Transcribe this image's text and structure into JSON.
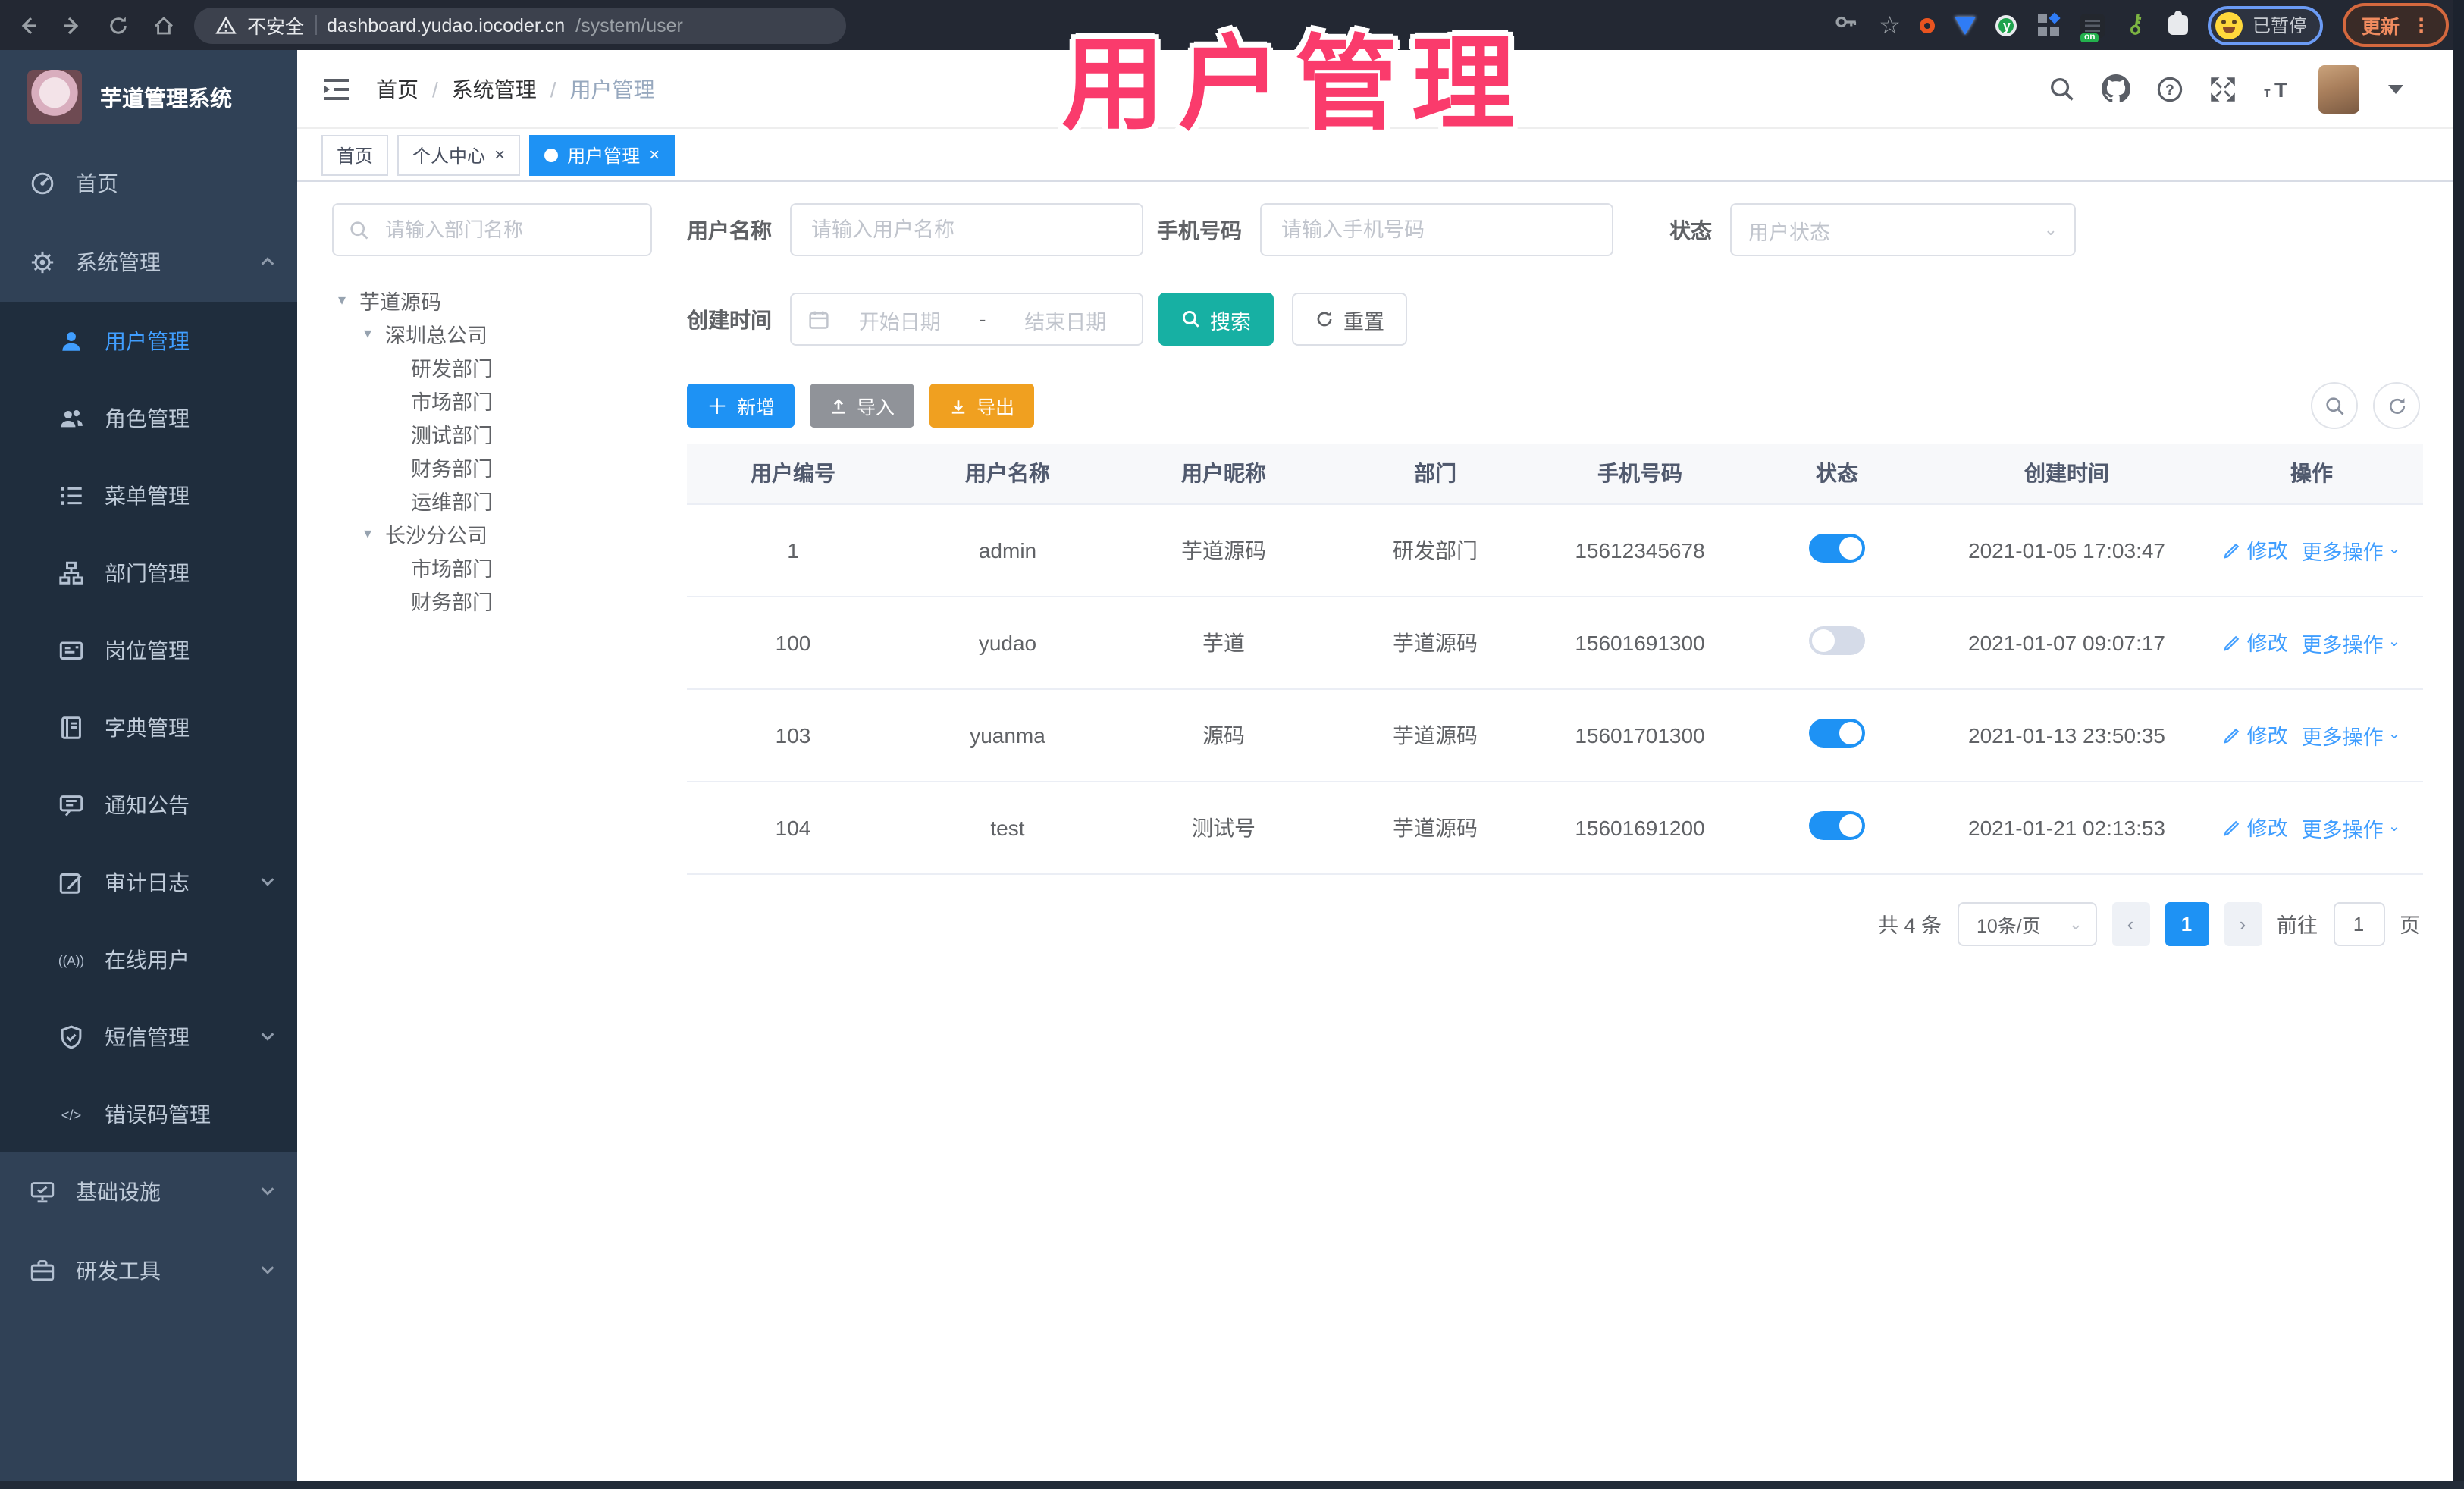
{
  "colors": {
    "primary": "#1e92f4",
    "link": "#409eff",
    "teal": "#17b0a3",
    "warning": "#f0a020",
    "info": "#909399",
    "pink": "#fa3b6c"
  },
  "overlay_title": "用户管理",
  "browser": {
    "not_secure": "不安全",
    "url_host": "dashboard.yudao.iocoder.cn",
    "url_path": "/system/user",
    "profile_status": "已暂停",
    "update_label": "更新",
    "menu_dots": "⋮",
    "extension_icons": [
      "key-icon",
      "star-icon",
      "ubuntu-icon",
      "gem-icon",
      "y-circle-icon",
      "grid-icon",
      "onpage-icon",
      "green-key-icon",
      "puzzle-icon"
    ]
  },
  "sidebar": {
    "app_title": "芋道管理系统",
    "items": [
      {
        "label": "首页",
        "icon": "dashboard",
        "level": "top"
      },
      {
        "label": "系统管理",
        "icon": "gear",
        "level": "top",
        "chevron": "up"
      },
      {
        "label": "用户管理",
        "icon": "user",
        "level": "sub",
        "active": true
      },
      {
        "label": "角色管理",
        "icon": "roles",
        "level": "sub"
      },
      {
        "label": "菜单管理",
        "icon": "menu",
        "level": "sub"
      },
      {
        "label": "部门管理",
        "icon": "dept",
        "level": "sub"
      },
      {
        "label": "岗位管理",
        "icon": "post",
        "level": "sub"
      },
      {
        "label": "字典管理",
        "icon": "dict",
        "level": "sub"
      },
      {
        "label": "通知公告",
        "icon": "notice",
        "level": "sub"
      },
      {
        "label": "审计日志",
        "icon": "audit",
        "level": "sub",
        "chevron": "down"
      },
      {
        "label": "在线用户",
        "icon": "online",
        "level": "sub"
      },
      {
        "label": "短信管理",
        "icon": "sms",
        "level": "sub",
        "chevron": "down"
      },
      {
        "label": "错误码管理",
        "icon": "errcode",
        "level": "sub"
      },
      {
        "label": "基础设施",
        "icon": "infra",
        "level": "top",
        "chevron": "down"
      },
      {
        "label": "研发工具",
        "icon": "tools",
        "level": "top",
        "chevron": "down"
      }
    ]
  },
  "navbar": {
    "breadcrumb": [
      "首页",
      "系统管理",
      "用户管理"
    ],
    "icons": [
      "search-icon",
      "github-icon",
      "help-icon",
      "fullscreen-icon",
      "font-size-icon"
    ]
  },
  "tabs": [
    {
      "label": "首页",
      "closable": false,
      "active": false
    },
    {
      "label": "个人中心",
      "closable": true,
      "active": false
    },
    {
      "label": "用户管理",
      "closable": true,
      "active": true
    }
  ],
  "dept_panel": {
    "search_placeholder": "请输入部门名称",
    "tree": [
      {
        "label": "芋道源码",
        "children": [
          {
            "label": "深圳总公司",
            "children": [
              {
                "label": "研发部门"
              },
              {
                "label": "市场部门"
              },
              {
                "label": "测试部门"
              },
              {
                "label": "财务部门"
              },
              {
                "label": "运维部门"
              }
            ]
          },
          {
            "label": "长沙分公司",
            "children": [
              {
                "label": "市场部门"
              },
              {
                "label": "财务部门"
              }
            ]
          }
        ]
      }
    ]
  },
  "filters": {
    "username_label": "用户名称",
    "username_placeholder": "请输入用户名称",
    "mobile_label": "手机号码",
    "mobile_placeholder": "请输入手机号码",
    "status_label": "状态",
    "status_placeholder": "用户状态",
    "created_label": "创建时间",
    "date_start_placeholder": "开始日期",
    "date_separator": "-",
    "date_end_placeholder": "结束日期",
    "search_label": "搜索",
    "reset_label": "重置"
  },
  "toolbar": {
    "add_label": "新增",
    "import_label": "导入",
    "export_label": "导出"
  },
  "table": {
    "headers": [
      "用户编号",
      "用户名称",
      "用户昵称",
      "部门",
      "手机号码",
      "状态",
      "创建时间",
      "操作"
    ],
    "edit_label": "修改",
    "more_label": "更多操作",
    "rows": [
      {
        "id": "1",
        "name": "admin",
        "nick": "芋道源码",
        "dept": "研发部门",
        "mobile": "15612345678",
        "status": true,
        "created": "2021-01-05 17:03:47"
      },
      {
        "id": "100",
        "name": "yudao",
        "nick": "芋道",
        "dept": "芋道源码",
        "mobile": "15601691300",
        "status": false,
        "created": "2021-01-07 09:07:17"
      },
      {
        "id": "103",
        "name": "yuanma",
        "nick": "源码",
        "dept": "芋道源码",
        "mobile": "15601701300",
        "status": true,
        "created": "2021-01-13 23:50:35"
      },
      {
        "id": "104",
        "name": "test",
        "nick": "测试号",
        "dept": "芋道源码",
        "mobile": "15601691200",
        "status": true,
        "created": "2021-01-21 02:13:53"
      }
    ]
  },
  "pagination": {
    "total": "共 4 条",
    "page_size": "10条/页",
    "prev": "‹",
    "current": "1",
    "next": "›",
    "goto_label": "前往",
    "page_input": "1",
    "unit_label": "页"
  }
}
